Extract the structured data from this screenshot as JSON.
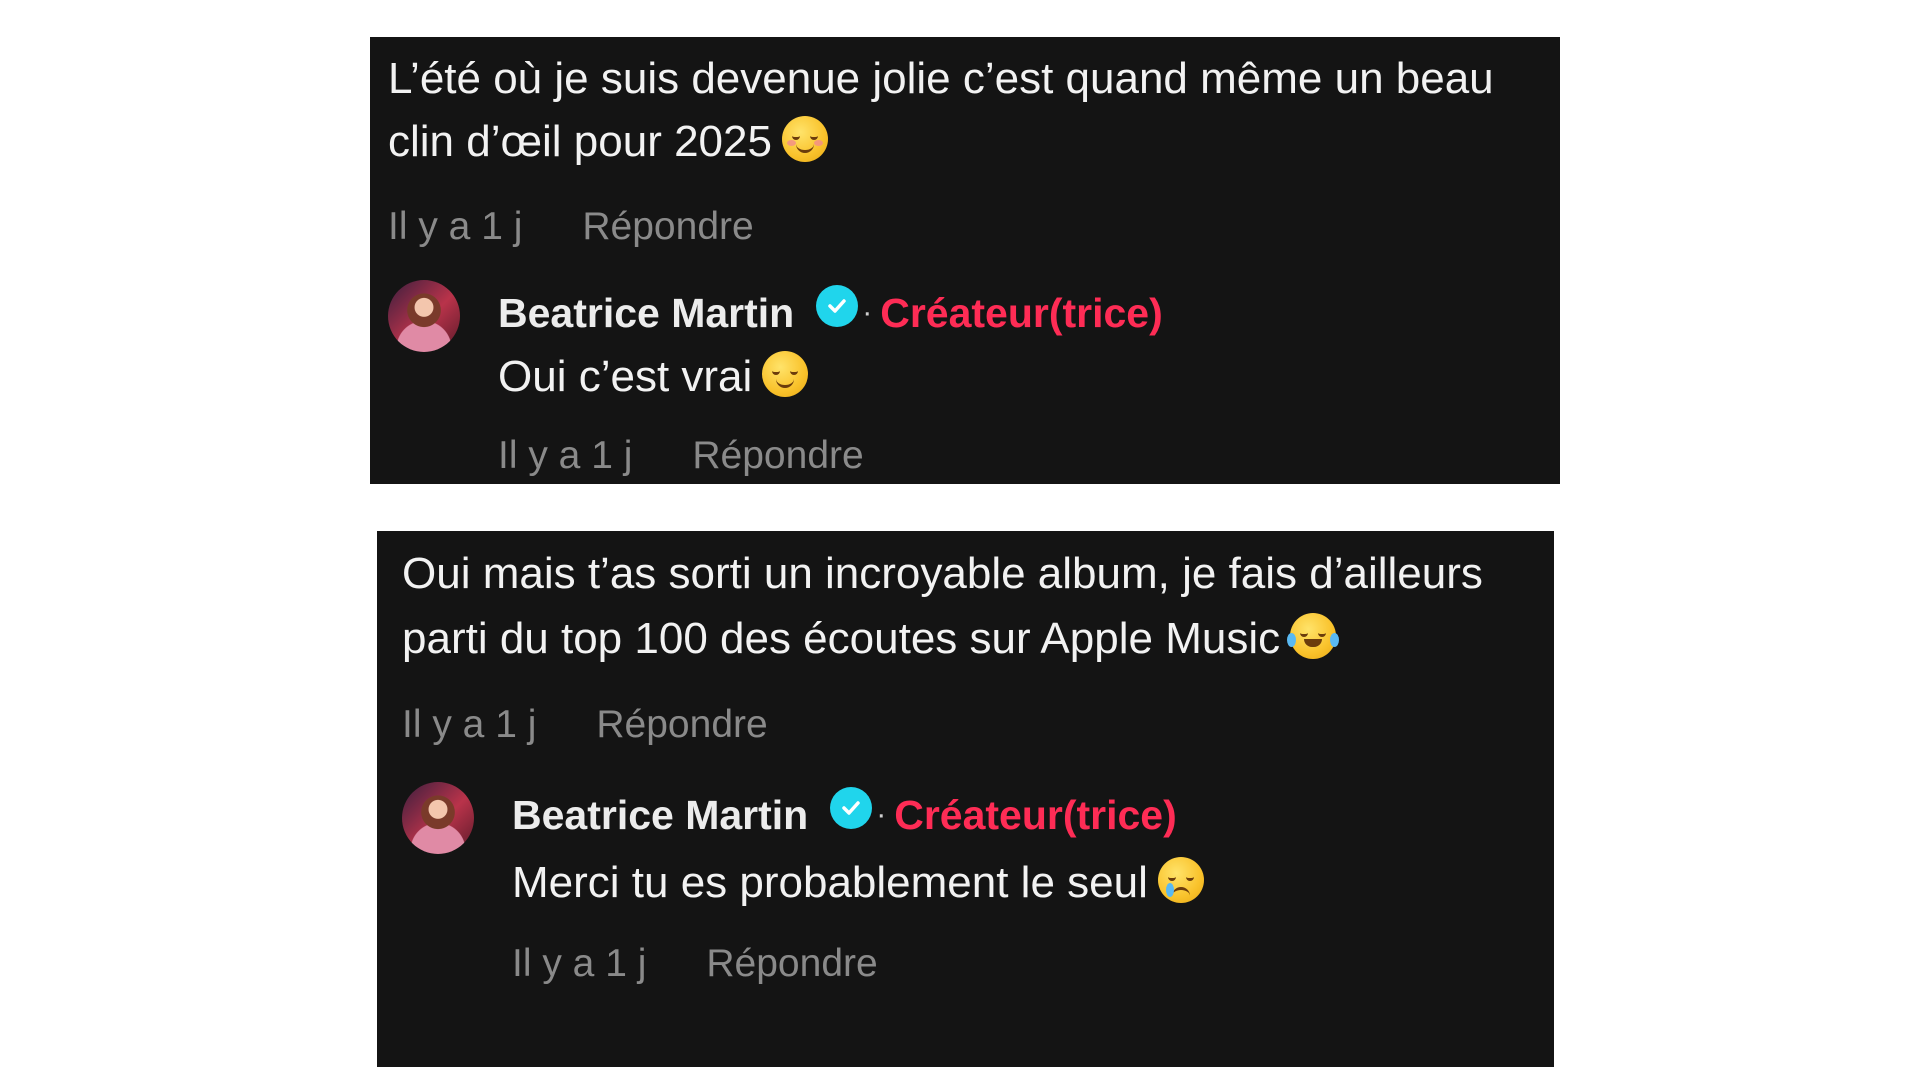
{
  "threads": [
    {
      "comment": {
        "text": "L’été où je suis devenue jolie c’est quand même un beau clin d’œil pour 2025",
        "emoji": "smiling-face-with-blush",
        "time": "Il y a 1 j",
        "reply_label": "Répondre"
      },
      "reply": {
        "author": "Beatrice Martin",
        "badge": "Créateur(trice)",
        "separator": "·",
        "text": "Oui c’est vrai",
        "emoji": "relieved-face",
        "time": "Il y a 1 j",
        "reply_label": "Répondre"
      }
    },
    {
      "comment": {
        "text": "Oui mais t’as sorti un incroyable album, je fais d’ailleurs parti du top 100 des écoutes sur Apple Music",
        "emoji": "face-with-tears-of-joy",
        "time": "Il y a 1 j",
        "reply_label": "Répondre"
      },
      "reply": {
        "author": "Beatrice Martin",
        "badge": "Créateur(trice)",
        "separator": "·",
        "text": "Merci tu es probablement le seul",
        "emoji": "face-holding-back-tears",
        "time": "Il y a 1 j",
        "reply_label": "Répondre"
      }
    }
  ],
  "colors": {
    "panel_bg": "#141414",
    "text": "#f2f2f2",
    "meta": "#8a8a8a",
    "creator_badge": "#fe2c55",
    "verified": "#20d5ec"
  }
}
